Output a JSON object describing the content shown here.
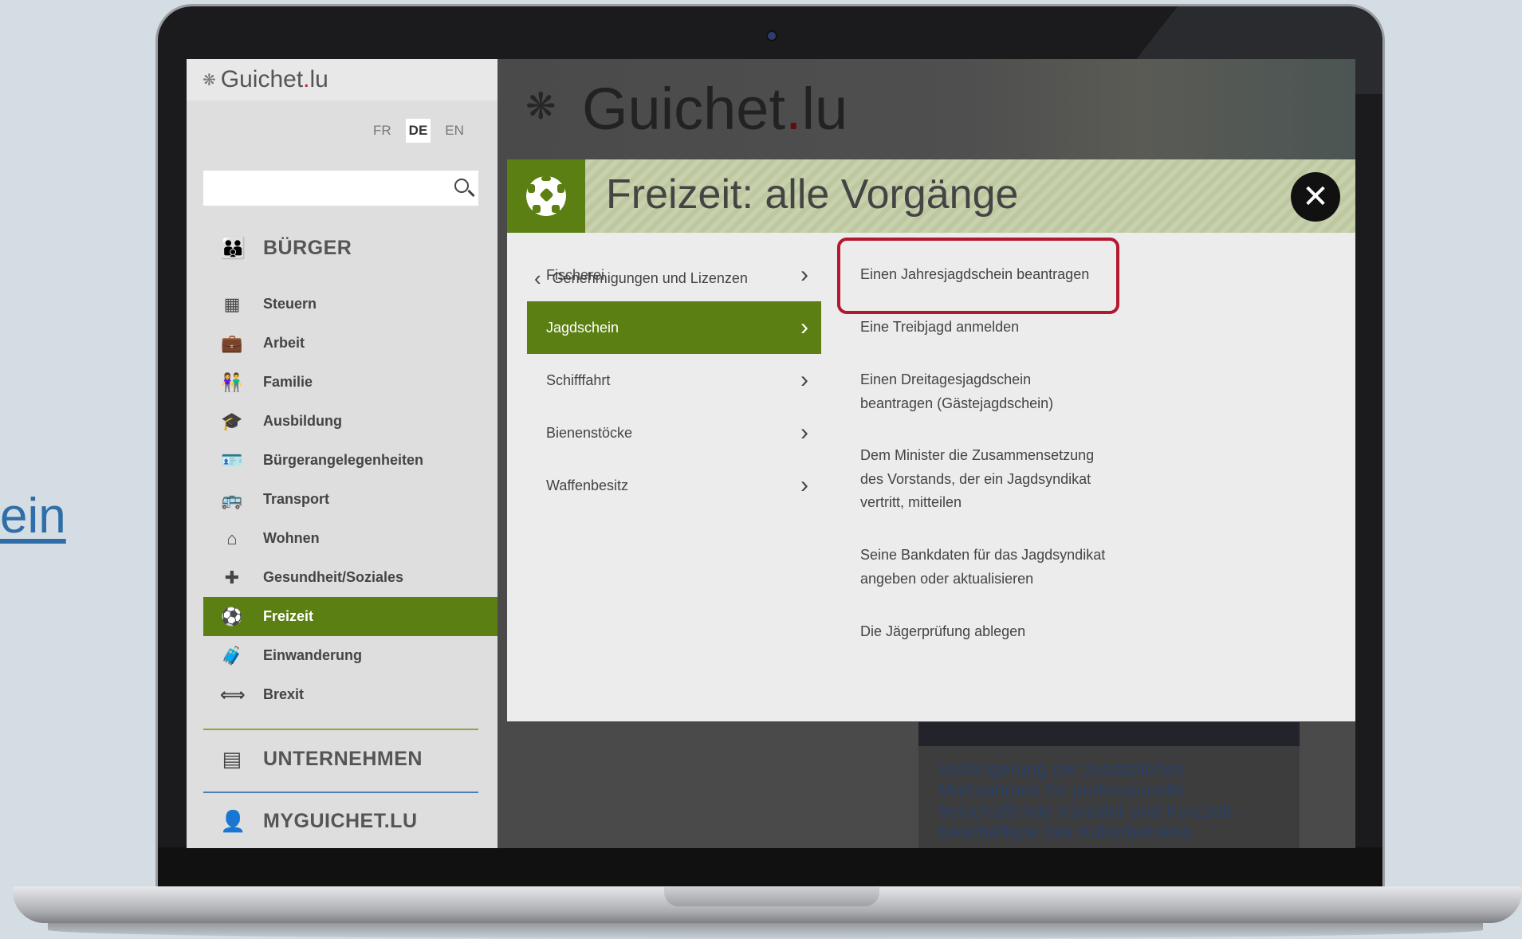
{
  "background": {
    "link_text": "ein"
  },
  "sidebar": {
    "logo": {
      "text_main": "Guichet",
      "text_dot": ".",
      "text_tld": "lu"
    },
    "languages": [
      "FR",
      "DE",
      "EN"
    ],
    "active_language": "DE",
    "search": {
      "placeholder": ""
    },
    "sections": {
      "buerger": "BÜRGER",
      "unternehmen": "UNTERNEHMEN",
      "myguichet": "MYGUICHET.LU"
    },
    "items": [
      {
        "label": "Steuern",
        "icon": "calculator-icon"
      },
      {
        "label": "Arbeit",
        "icon": "briefcase-icon"
      },
      {
        "label": "Familie",
        "icon": "family-icon"
      },
      {
        "label": "Ausbildung",
        "icon": "graduation-cap-icon"
      },
      {
        "label": "Bürgerangelegenheiten",
        "icon": "id-card-icon"
      },
      {
        "label": "Transport",
        "icon": "bus-icon"
      },
      {
        "label": "Wohnen",
        "icon": "house-icon"
      },
      {
        "label": "Gesundheit/Soziales",
        "icon": "medical-kit-icon"
      },
      {
        "label": "Freizeit",
        "icon": "soccer-ball-icon"
      },
      {
        "label": "Einwanderung",
        "icon": "immigration-icon"
      },
      {
        "label": "Brexit",
        "icon": "brexit-icon"
      }
    ],
    "active_item": "Freizeit"
  },
  "main": {
    "logo": {
      "text_main": "Guichet",
      "text_dot": ".",
      "text_tld": "lu"
    },
    "news_title": "Verlängerung der zusätzlichen Maßnahmen für professionelle freischaffende Künstler und Kurzzeit-Beschäftigte des Kulturbetriebs"
  },
  "modal": {
    "title": "Freizeit: alle Vorgänge",
    "back_label": "Genehmigungen und Lizenzen",
    "subcategories": [
      "Fischerei",
      "Jagdschein",
      "Schifffahrt",
      "Bienenstöcke",
      "Waffenbesitz"
    ],
    "active_subcategory": "Jagdschein",
    "procedures": [
      "Einen Jahresjagdschein beantragen",
      "Eine Treibjagd anmelden",
      "Einen Dreitagesjagdschein beantragen (Gästejagdschein)",
      "Dem Minister die Zusammensetzung des Vorstands, der ein Jagdsyndikat vertritt, mitteilen",
      "Seine Bankdaten für das Jagdsyndikat angeben oder aktualisieren",
      "Die Jägerprüfung ablegen"
    ],
    "highlighted_procedure": "Einen Jahresjagdschein beantragen"
  },
  "colors": {
    "accent_green": "#5b7f12",
    "highlight_red": "#b3182f",
    "link_blue": "#2f6ea8"
  }
}
